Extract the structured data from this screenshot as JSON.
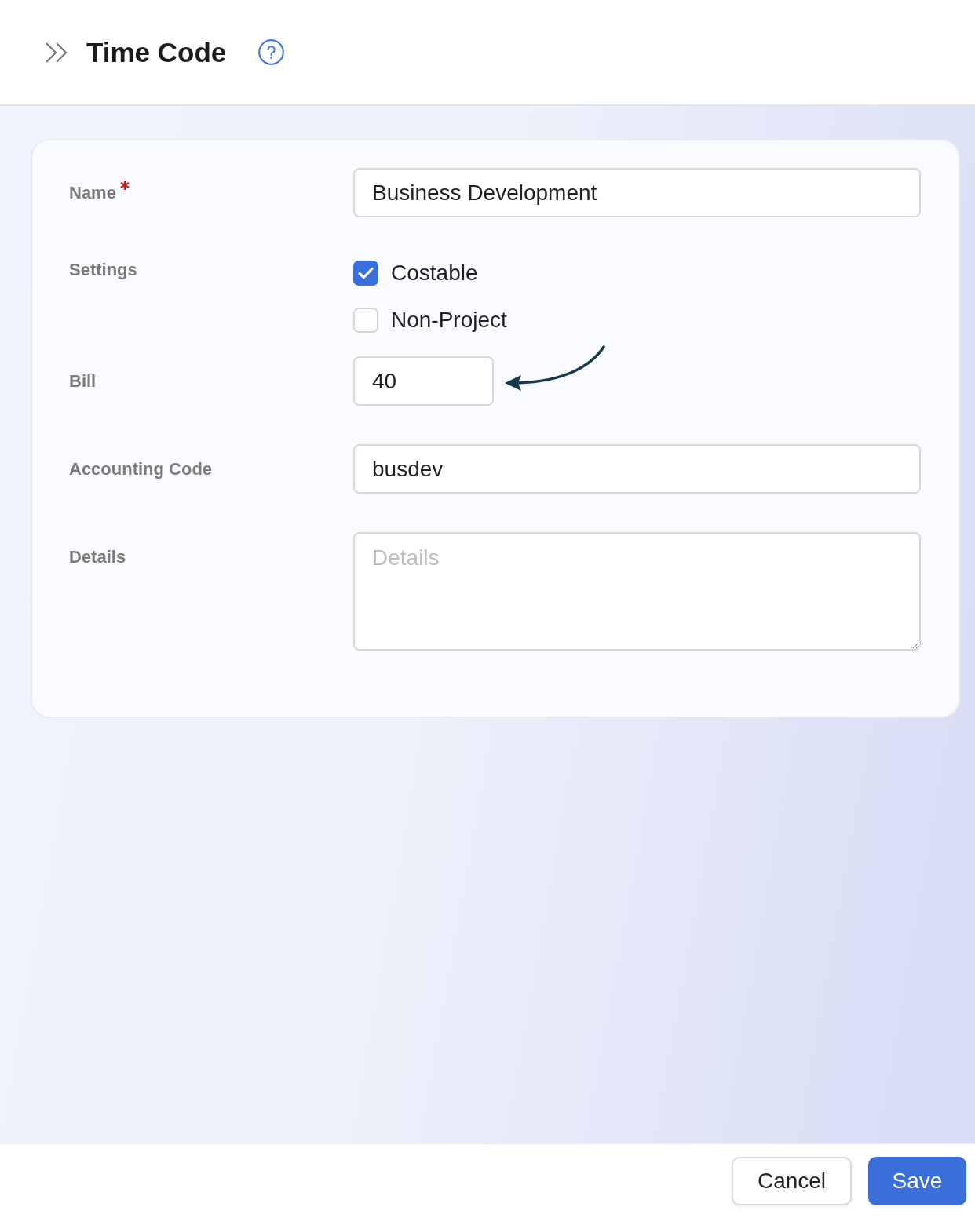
{
  "header": {
    "title": "Time Code"
  },
  "form": {
    "fields": [
      {
        "kind": "text",
        "label": "Name",
        "required": true,
        "value": "Business Development"
      },
      {
        "kind": "checkboxes",
        "label": "Settings",
        "options": [
          {
            "label": "Costable",
            "checked": true
          },
          {
            "label": "Non-Project",
            "checked": false
          }
        ]
      },
      {
        "kind": "number",
        "label": "Bill",
        "required": false,
        "value": "40",
        "pointer_arrow": true
      },
      {
        "kind": "text",
        "label": "Accounting Code",
        "required": false,
        "value": "busdev"
      },
      {
        "kind": "textarea",
        "label": "Details",
        "required": false,
        "placeholder": "Details"
      }
    ]
  },
  "buttons": [
    {
      "kind": "secondary",
      "label": "Cancel"
    },
    {
      "kind": "primary",
      "label": "Save"
    }
  ]
}
